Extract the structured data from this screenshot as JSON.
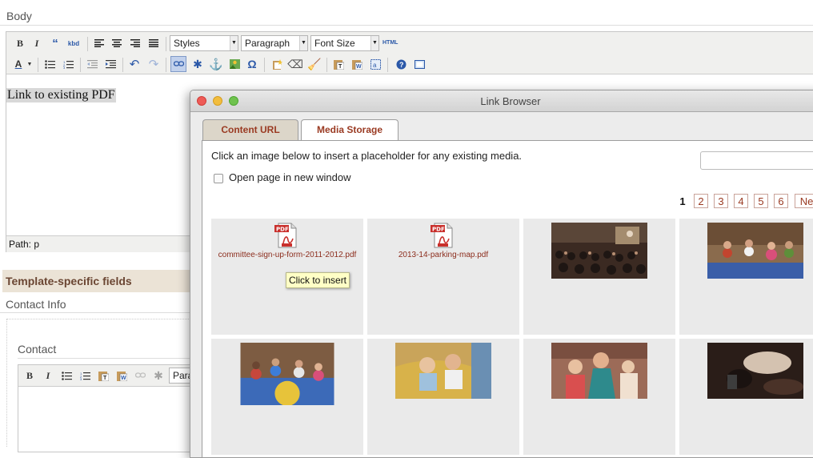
{
  "body_field": {
    "label": "Body",
    "toolbar": {
      "styles_select": "Styles",
      "block_select": "Paragraph",
      "font_size_select": "Font Size",
      "html_label": "HTML"
    },
    "content_text": "Link to existing PDF",
    "status_path": "Path: p"
  },
  "template_fields": {
    "header": "Template-specific fields",
    "contact_info_label": "Contact Info",
    "contact_label": "Contact",
    "contact_select_partial": "Para"
  },
  "link_browser": {
    "title": "Link Browser",
    "tabs": [
      {
        "label": "Content URL",
        "active": false
      },
      {
        "label": "Media Storage",
        "active": true
      }
    ],
    "instructions": "Click an image below to insert a placeholder for any existing media.",
    "search_placeholder": "",
    "open_new_window_label": "Open page in new window",
    "pagination": {
      "current": "1",
      "pages": [
        "2",
        "3",
        "4",
        "5",
        "6"
      ],
      "next_partial": "Ne"
    },
    "media_items": [
      {
        "type": "pdf",
        "icon": "pdf-icon",
        "filename": "committee-sign-up-form-2011-2012.pdf"
      },
      {
        "type": "pdf",
        "icon": "pdf-icon",
        "filename": "2013-14-parking-map.pdf"
      },
      {
        "type": "photo",
        "description_colors": [
          "#3a2a22",
          "#6b4f3f"
        ]
      },
      {
        "type": "photo",
        "description_colors": [
          "#8a6b4d",
          "#c2452f"
        ]
      },
      {
        "type": "photo",
        "description_colors": [
          "#c7473c",
          "#3c6ab8"
        ]
      },
      {
        "type": "photo",
        "description_colors": [
          "#d8b24a",
          "#7c5a3b"
        ]
      },
      {
        "type": "photo",
        "description_colors": [
          "#9c6b58",
          "#2e8a8c"
        ]
      },
      {
        "type": "photo",
        "description_colors": [
          "#2a1d18",
          "#d4c2b0"
        ]
      }
    ],
    "tooltip": "Click to insert"
  },
  "colors": {
    "accent_link": "#9a3a22",
    "tab_inactive_bg": "#dcd6c9",
    "tooltip_bg": "#ffffc6"
  }
}
